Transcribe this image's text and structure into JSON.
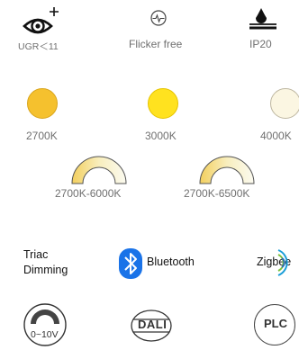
{
  "features": {
    "ugr": {
      "label": "UGR＜11",
      "icon": "eye-plus-icon"
    },
    "flicker": {
      "label": "Flicker free",
      "icon": "flicker-free-icon"
    },
    "ip": {
      "label": "IP20",
      "icon": "water-drop-icon"
    }
  },
  "cct_single": [
    {
      "label": "2700K",
      "color": "#f5c12e"
    },
    {
      "label": "3000K",
      "color": "#ffe21f"
    },
    {
      "label": "4000K",
      "color": "#fbf6e2"
    }
  ],
  "cct_tunable": [
    {
      "label": "2700K-6000K",
      "icon": "tunable-white-arc-icon"
    },
    {
      "label": "2700K-6500K",
      "icon": "tunable-white-arc-icon"
    }
  ],
  "controls_row1": {
    "triac": {
      "line1": "Triac",
      "line2": "Dimming"
    },
    "bluetooth": {
      "label": "Bluetooth",
      "icon": "bluetooth-icon",
      "color": "#1a73e8"
    },
    "zigbee": {
      "label": "Zigbee",
      "icon": "zigbee-icon",
      "color": "#7cbf3c"
    }
  },
  "controls_row2": {
    "analog": {
      "label": "0~10V",
      "icon": "dimmer-dial-icon"
    },
    "dali": {
      "label": "DALI",
      "icon": "dali-badge-icon"
    },
    "plc": {
      "label": "PLC",
      "icon": "plc-badge-icon"
    }
  }
}
